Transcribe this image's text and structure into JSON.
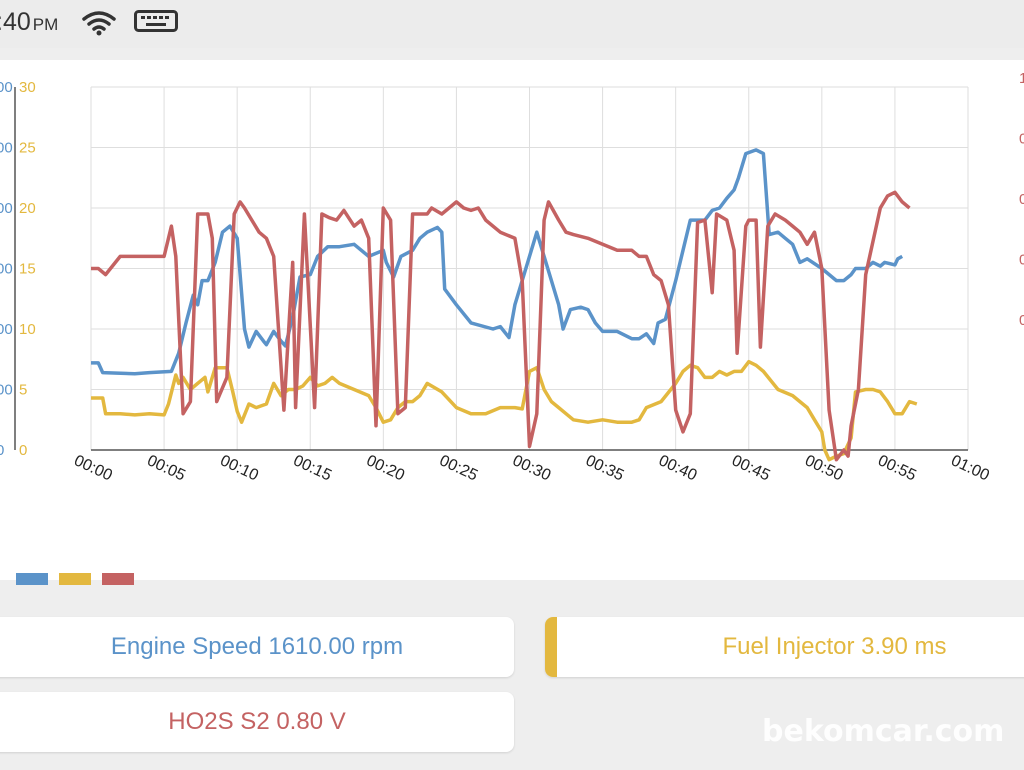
{
  "status_bar": {
    "time": ":40",
    "ampm": "PM"
  },
  "colors": {
    "engine_speed": "#5b93c9",
    "fuel_injector": "#e3b83f",
    "ho2s": "#c46262",
    "grid": "#dedede"
  },
  "chart_data": {
    "type": "line",
    "x_tick_labels": [
      "00:00",
      "00:05",
      "00:10",
      "00:15",
      "00:20",
      "00:25",
      "00:30",
      "00:35",
      "00:40",
      "00:45",
      "00:50",
      "00:55",
      "01:00"
    ],
    "xlim": [
      0,
      60
    ],
    "left_axis_1": {
      "ticks": [
        "00",
        "00",
        "00",
        "00",
        "00",
        "00",
        "0"
      ],
      "color": "#5b93c9"
    },
    "left_axis_2": {
      "ticks": [
        "30",
        "25",
        "20",
        "15",
        "10",
        "5",
        "0"
      ],
      "ylim": [
        0,
        30
      ],
      "color": "#e3b83f"
    },
    "right_axis": {
      "ticks": [
        "1",
        "0",
        "0",
        "0",
        "0"
      ],
      "color": "#c46262"
    },
    "series": [
      {
        "key": "engine_speed",
        "color": "#5b93c9",
        "points": [
          [
            0,
            7.2
          ],
          [
            0.5,
            7.2
          ],
          [
            0.8,
            6.4
          ],
          [
            3,
            6.3
          ],
          [
            4,
            6.4
          ],
          [
            5.5,
            6.5
          ],
          [
            6,
            8
          ],
          [
            6.5,
            10.5
          ],
          [
            7,
            12.8
          ],
          [
            7.3,
            12
          ],
          [
            7.6,
            14
          ],
          [
            8,
            14
          ],
          [
            8.5,
            15.5
          ],
          [
            9,
            18
          ],
          [
            9.5,
            18.5
          ],
          [
            10,
            17.5
          ],
          [
            10.5,
            10
          ],
          [
            10.8,
            8.5
          ],
          [
            11.3,
            9.8
          ],
          [
            11.8,
            9
          ],
          [
            12,
            8.7
          ],
          [
            12.5,
            9.8
          ],
          [
            13,
            9
          ],
          [
            13.3,
            8.6
          ],
          [
            13.8,
            11
          ],
          [
            14.3,
            14.3
          ],
          [
            15,
            14.5
          ],
          [
            15.5,
            16
          ],
          [
            16.2,
            16.8
          ],
          [
            17,
            16.8
          ],
          [
            18,
            17
          ],
          [
            19,
            16
          ],
          [
            20,
            16.5
          ],
          [
            20.2,
            15.5
          ],
          [
            20.7,
            14.3
          ],
          [
            21.2,
            16
          ],
          [
            22,
            16.5
          ],
          [
            22.5,
            17.5
          ],
          [
            23,
            18
          ],
          [
            23.7,
            18.4
          ],
          [
            24,
            18
          ],
          [
            24.2,
            13.3
          ],
          [
            25,
            12
          ],
          [
            26,
            10.5
          ],
          [
            27.5,
            10
          ],
          [
            28,
            10.2
          ],
          [
            28.6,
            9.3
          ],
          [
            29,
            12
          ],
          [
            30,
            16
          ],
          [
            30.5,
            18
          ],
          [
            31,
            16
          ],
          [
            32,
            12
          ],
          [
            32.3,
            10
          ],
          [
            32.8,
            11.6
          ],
          [
            33.5,
            11.8
          ],
          [
            34,
            11.6
          ],
          [
            34.5,
            10.5
          ],
          [
            35,
            9.8
          ],
          [
            36,
            9.8
          ],
          [
            37,
            9.2
          ],
          [
            37.5,
            9.2
          ],
          [
            38,
            9.6
          ],
          [
            38.5,
            8.8
          ],
          [
            38.8,
            10.5
          ],
          [
            39.3,
            10.8
          ],
          [
            40,
            14
          ],
          [
            40.5,
            16.5
          ],
          [
            41,
            19
          ],
          [
            42,
            19
          ],
          [
            42.5,
            19.8
          ],
          [
            43,
            20
          ],
          [
            43.5,
            20.8
          ],
          [
            44,
            21.5
          ],
          [
            44.3,
            22.5
          ],
          [
            44.8,
            24.5
          ],
          [
            45.5,
            24.8
          ],
          [
            46,
            24.5
          ],
          [
            46.4,
            17.8
          ],
          [
            47,
            18
          ],
          [
            47.5,
            17.5
          ],
          [
            48,
            17
          ],
          [
            48.5,
            15.5
          ],
          [
            49,
            15.8
          ],
          [
            50,
            15
          ],
          [
            51,
            14
          ],
          [
            51.5,
            14
          ],
          [
            52,
            14.5
          ],
          [
            52.3,
            15
          ],
          [
            53,
            15
          ],
          [
            53.5,
            15.5
          ],
          [
            54,
            15.2
          ],
          [
            54.3,
            15.5
          ],
          [
            55,
            15.3
          ],
          [
            55.2,
            15.8
          ],
          [
            55.5,
            16
          ]
        ]
      },
      {
        "key": "fuel_injector",
        "color": "#e3b83f",
        "points": [
          [
            0,
            4.3
          ],
          [
            0.8,
            4.3
          ],
          [
            1,
            3
          ],
          [
            2,
            3
          ],
          [
            3,
            2.9
          ],
          [
            4,
            3
          ],
          [
            5,
            2.9
          ],
          [
            5.3,
            3.8
          ],
          [
            5.8,
            6.2
          ],
          [
            6,
            5.5
          ],
          [
            6.3,
            6
          ],
          [
            6.8,
            5
          ],
          [
            7.3,
            5.5
          ],
          [
            7.8,
            6
          ],
          [
            8,
            4.8
          ],
          [
            8.5,
            6.8
          ],
          [
            9.3,
            6.8
          ],
          [
            9.7,
            4.8
          ],
          [
            10,
            3.2
          ],
          [
            10.3,
            2.3
          ],
          [
            10.8,
            3.8
          ],
          [
            11.3,
            3.5
          ],
          [
            12,
            3.8
          ],
          [
            12.5,
            5.5
          ],
          [
            13,
            4.5
          ],
          [
            13.5,
            5
          ],
          [
            14,
            5
          ],
          [
            14.5,
            5.3
          ],
          [
            15,
            6
          ],
          [
            15.5,
            5.3
          ],
          [
            16,
            5.5
          ],
          [
            16.5,
            6
          ],
          [
            17,
            5.5
          ],
          [
            18,
            5
          ],
          [
            19,
            4.5
          ],
          [
            19.5,
            3.5
          ],
          [
            20,
            2.3
          ],
          [
            20.5,
            2.5
          ],
          [
            21,
            3.5
          ],
          [
            21.5,
            4
          ],
          [
            22,
            4
          ],
          [
            22.5,
            4.5
          ],
          [
            23,
            5.5
          ],
          [
            24,
            4.8
          ],
          [
            25,
            3.5
          ],
          [
            26,
            3
          ],
          [
            27,
            3
          ],
          [
            28,
            3.5
          ],
          [
            29,
            3.5
          ],
          [
            29.5,
            3.4
          ],
          [
            30,
            6.5
          ],
          [
            30.5,
            6.8
          ],
          [
            31,
            5
          ],
          [
            31.5,
            4
          ],
          [
            32,
            3.5
          ],
          [
            32.5,
            3
          ],
          [
            33,
            2.5
          ],
          [
            34,
            2.3
          ],
          [
            35,
            2.5
          ],
          [
            36,
            2.3
          ],
          [
            37,
            2.3
          ],
          [
            37.5,
            2.5
          ],
          [
            38,
            3.5
          ],
          [
            39,
            4
          ],
          [
            40,
            5.5
          ],
          [
            40.5,
            6.5
          ],
          [
            41,
            7
          ],
          [
            41.5,
            6.8
          ],
          [
            42,
            6
          ],
          [
            42.5,
            6
          ],
          [
            43,
            6.5
          ],
          [
            43.5,
            6.2
          ],
          [
            44,
            6.5
          ],
          [
            44.5,
            6.5
          ],
          [
            45,
            7.3
          ],
          [
            45.5,
            7
          ],
          [
            46,
            6.5
          ],
          [
            47,
            5
          ],
          [
            48,
            4.5
          ],
          [
            49,
            3.5
          ],
          [
            49.5,
            2.5
          ],
          [
            50,
            1.5
          ],
          [
            50.2,
            0
          ],
          [
            50.5,
            -0.8
          ],
          [
            51,
            -0.5
          ],
          [
            51.5,
            -0.3
          ],
          [
            52,
            1
          ],
          [
            52.3,
            4.8
          ],
          [
            53,
            5
          ],
          [
            53.5,
            5
          ],
          [
            54,
            4.8
          ],
          [
            54.5,
            4
          ],
          [
            55,
            3
          ],
          [
            55.5,
            3
          ],
          [
            56,
            4
          ],
          [
            56.5,
            3.8
          ]
        ]
      },
      {
        "key": "ho2s",
        "color": "#c46262",
        "points": [
          [
            0,
            15
          ],
          [
            0.5,
            15
          ],
          [
            1,
            14.5
          ],
          [
            2,
            16
          ],
          [
            3,
            16
          ],
          [
            4,
            16
          ],
          [
            5,
            16
          ],
          [
            5.5,
            18.5
          ],
          [
            5.8,
            16
          ],
          [
            6.3,
            3
          ],
          [
            6.8,
            4
          ],
          [
            7.3,
            19.5
          ],
          [
            8,
            19.5
          ],
          [
            8.3,
            17.5
          ],
          [
            8.6,
            4
          ],
          [
            9.3,
            6
          ],
          [
            9.8,
            19.5
          ],
          [
            10.2,
            20.5
          ],
          [
            10.5,
            20
          ],
          [
            11,
            19
          ],
          [
            11.5,
            18
          ],
          [
            12,
            17.5
          ],
          [
            12.5,
            16
          ],
          [
            13.2,
            3.3
          ],
          [
            13.8,
            15.5
          ],
          [
            14,
            3.5
          ],
          [
            14.6,
            19.5
          ],
          [
            15.3,
            3.5
          ],
          [
            15.8,
            19.5
          ],
          [
            16.3,
            19.2
          ],
          [
            16.8,
            19
          ],
          [
            17.3,
            19.8
          ],
          [
            18,
            18.5
          ],
          [
            18.5,
            19
          ],
          [
            19,
            17.5
          ],
          [
            19.5,
            2
          ],
          [
            20,
            20
          ],
          [
            20.5,
            19
          ],
          [
            21,
            3
          ],
          [
            21.5,
            3.5
          ],
          [
            22,
            19.5
          ],
          [
            23,
            19.5
          ],
          [
            23.3,
            20
          ],
          [
            24,
            19.5
          ],
          [
            25,
            20.5
          ],
          [
            25.5,
            20
          ],
          [
            26,
            19.8
          ],
          [
            26.5,
            20
          ],
          [
            27,
            19
          ],
          [
            28,
            18
          ],
          [
            29,
            17.5
          ],
          [
            29.5,
            14
          ],
          [
            30,
            0.3
          ],
          [
            30.5,
            3
          ],
          [
            31,
            19
          ],
          [
            31.3,
            20.5
          ],
          [
            32,
            19
          ],
          [
            32.5,
            18
          ],
          [
            33,
            17.8
          ],
          [
            34,
            17.5
          ],
          [
            35,
            17
          ],
          [
            36,
            16.5
          ],
          [
            37,
            16.5
          ],
          [
            37.5,
            16
          ],
          [
            38,
            16
          ],
          [
            38.5,
            14.5
          ],
          [
            39,
            14
          ],
          [
            39.5,
            12
          ],
          [
            40,
            3.3
          ],
          [
            40.5,
            1.5
          ],
          [
            41,
            3
          ],
          [
            41.5,
            18.8
          ],
          [
            42,
            19
          ],
          [
            42.5,
            13
          ],
          [
            42.8,
            19.5
          ],
          [
            43.5,
            19
          ],
          [
            44,
            16.5
          ],
          [
            44.2,
            8
          ],
          [
            44.8,
            18.5
          ],
          [
            45,
            19
          ],
          [
            45.5,
            19
          ],
          [
            45.8,
            8.5
          ],
          [
            46.3,
            18.5
          ],
          [
            46.8,
            19.5
          ],
          [
            47.5,
            19
          ],
          [
            48,
            18.5
          ],
          [
            48.5,
            18
          ],
          [
            49,
            17
          ],
          [
            49.5,
            18
          ],
          [
            50,
            15
          ],
          [
            50.5,
            3.3
          ],
          [
            51,
            -0.8
          ],
          [
            51.5,
            0
          ],
          [
            51.8,
            -0.5
          ],
          [
            52,
            2
          ],
          [
            52.5,
            5
          ],
          [
            53,
            14.5
          ],
          [
            54,
            20
          ],
          [
            54.5,
            21
          ],
          [
            55,
            21.3
          ],
          [
            55.5,
            20.5
          ],
          [
            56,
            20
          ]
        ]
      }
    ]
  },
  "params": {
    "engine_speed": "Engine Speed 1610.00 rpm",
    "fuel_injector": "Fuel Injector 3.90 ms",
    "ho2s": "HO2S S2 0.80 V"
  },
  "watermark": "bekomcar.com"
}
